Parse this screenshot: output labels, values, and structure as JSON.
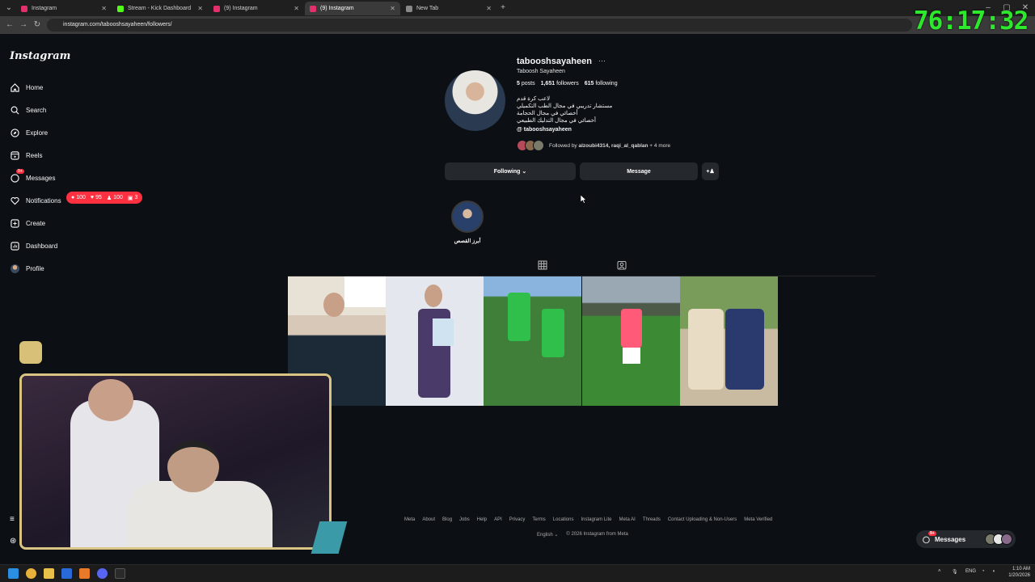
{
  "browser": {
    "tabs": [
      {
        "title": "Instagram",
        "color": "#e1306c"
      },
      {
        "title": "Stream - Kick Dashboard",
        "color": "#53fc18"
      },
      {
        "title": "(9) Instagram",
        "color": "#e1306c"
      },
      {
        "title": "(9) Instagram",
        "color": "#e1306c"
      },
      {
        "title": "New Tab",
        "color": "#888888"
      }
    ],
    "url": "instagram.com/tabooshsayaheen/followers/"
  },
  "overlay": {
    "timer": "76:17:32"
  },
  "sidebar": {
    "logo": "Instagram",
    "items": [
      {
        "label": "Home",
        "icon": "home-icon"
      },
      {
        "label": "Search",
        "icon": "search-icon"
      },
      {
        "label": "Explore",
        "icon": "compass-icon"
      },
      {
        "label": "Reels",
        "icon": "reels-icon"
      },
      {
        "label": "Messages",
        "icon": "messenger-icon"
      },
      {
        "label": "Notifications",
        "icon": "heart-icon"
      },
      {
        "label": "Create",
        "icon": "plus-icon"
      },
      {
        "label": "Dashboard",
        "icon": "chart-icon"
      },
      {
        "label": "Profile",
        "icon": "avatar"
      }
    ],
    "messages_badge": "9+",
    "notifications": {
      "comments": "100",
      "likes": "95",
      "follows": "100",
      "tags": "3"
    }
  },
  "profile": {
    "username": "tabooshsayaheen",
    "full_name": "Taboosh Sayaheen",
    "posts_count": "5",
    "posts_label": "posts",
    "followers_count": "1,651",
    "followers_label": "followers",
    "following_count": "615",
    "following_label": "following",
    "bio_lines": [
      "لاعب كرة قدم",
      "مستشار تدريبي في مجال الطب التكميلي",
      "أخصائي في مجال الحجامة",
      "أخصائي في مجال التدليك الطبيعي"
    ],
    "threads_link": "tabooshsayaheen",
    "followed_by_prefix": "Followed by",
    "followed_by_names": "alzoubi4314, raqi_al_qablan",
    "followed_by_more": "+ 4 more",
    "following_button": "Following",
    "message_button": "Message",
    "highlight_label": "أبرز القصص"
  },
  "footer": {
    "links": [
      "Meta",
      "About",
      "Blog",
      "Jobs",
      "Help",
      "API",
      "Privacy",
      "Terms",
      "Locations",
      "Instagram Lite",
      "Meta AI",
      "Threads",
      "Contact Uploading & Non-Users",
      "Meta Verified"
    ],
    "language": "English",
    "copyright": "© 2026 Instagram from Meta"
  },
  "floating_messages": {
    "label": "Messages",
    "badge": "9+"
  },
  "taskbar": {
    "lang": "ENG",
    "time": "1:10 AM",
    "date": "1/20/2026"
  }
}
